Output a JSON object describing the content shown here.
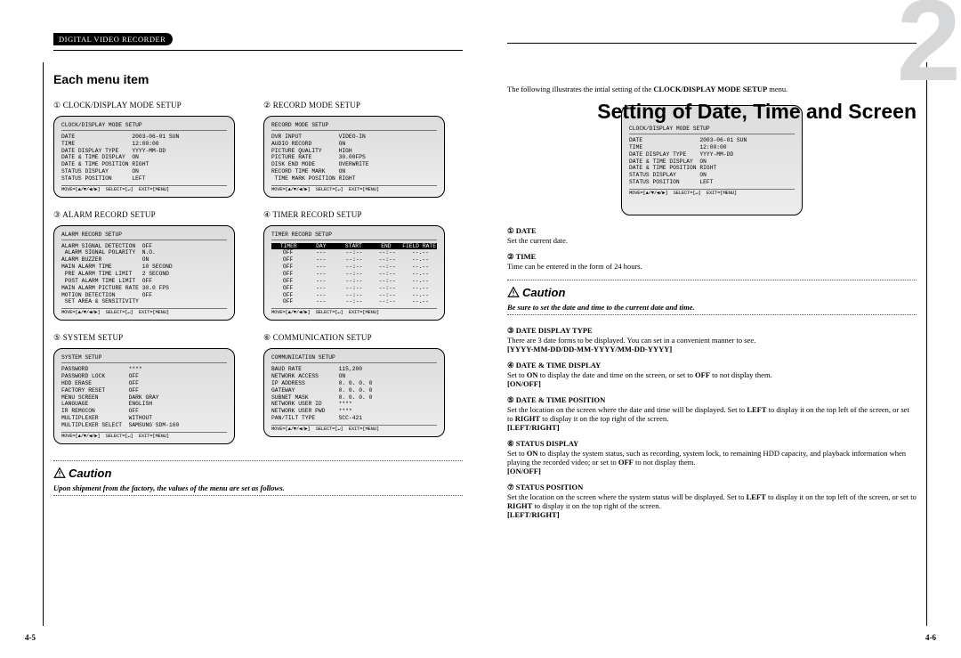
{
  "header_tag": "DIGITAL VIDEO RECORDER",
  "left": {
    "section_title": "Each menu item",
    "menus": [
      {
        "num": "①",
        "title": "CLOCK/DISPLAY MODE SETUP",
        "osd_title": "CLOCK/DISPLAY MODE SETUP",
        "osd_body": "DATE                 2003-06-01 SUN\nTIME                 12:00:00\nDATE DISPLAY TYPE    YYYY-MM-DD\nDATE & TIME DISPLAY  ON\nDATE & TIME POSITION RIGHT\nSTATUS DISPLAY       ON\nSTATUS POSITION      LEFT",
        "osd_foot": "MOVE=[▲/▼/◀/▶]  SELECT=[↵]  EXIT=[MENU]"
      },
      {
        "num": "②",
        "title": "RECORD MODE SETUP",
        "osd_title": "RECORD MODE SETUP",
        "osd_body": "DVR INPUT           VIDEO-IN\nAUDIO RECORD        ON\nPICTURE QUALITY     HIGH\nPICTURE RATE        30.00FPS\nDISK END MODE       OVERWRITE\nRECORD TIME MARK    ON\n TIME MARK POSITION RIGHT",
        "osd_foot": "MOVE=[▲/▼/◀/▶]  SELECT=[↵]  EXIT=[MENU]"
      },
      {
        "num": "③",
        "title": "ALARM RECORD SETUP",
        "osd_title": "ALARM RECORD SETUP",
        "osd_body": "ALARM SIGNAL DETECTION  OFF\n ALARM SIGNAL POLARITY  N.O.\nALARM BUZZER            ON\nMAIN ALARM TIME         10 SECOND\n PRE ALARM TIME LIMIT   2 SECOND\n POST ALARM TIME LIMIT  OFF\nMAIN ALARM PICTURE RATE 30.0 FPS\nMOTION DETECTION        OFF\n SET AREA & SENSITIVITY",
        "osd_foot": "MOVE=[▲/▼/◀/▶]  SELECT=[↵]  EXIT=[MENU]"
      },
      {
        "num": "④",
        "title": "TIMER RECORD SETUP",
        "osd_title": "TIMER RECORD SETUP",
        "osd_header": [
          "TIMER",
          "DAY",
          "START",
          "END",
          "FIELD RATE"
        ],
        "osd_rows": [
          [
            "OFF",
            "---",
            "--:--",
            "--:--",
            "--.--"
          ],
          [
            "OFF",
            "---",
            "--:--",
            "--:--",
            "--.--"
          ],
          [
            "OFF",
            "---",
            "--:--",
            "--:--",
            "--.--"
          ],
          [
            "OFF",
            "---",
            "--:--",
            "--:--",
            "--.--"
          ],
          [
            "OFF",
            "---",
            "--:--",
            "--:--",
            "--.--"
          ],
          [
            "OFF",
            "---",
            "--:--",
            "--:--",
            "--.--"
          ],
          [
            "OFF",
            "---",
            "--:--",
            "--:--",
            "--.--"
          ],
          [
            "OFF",
            "---",
            "--:--",
            "--:--",
            "--.--"
          ]
        ],
        "osd_foot": "MOVE=[▲/▼/◀/▶]  SELECT=[↵]  EXIT=[MENU]"
      },
      {
        "num": "⑤",
        "title": "SYSTEM SETUP",
        "osd_title": "SYSTEM SETUP",
        "osd_body": "PASSWORD            ****\nPASSWORD LOCK       OFF\nHDD ERASE           OFF\nFACTORY RESET       OFF\nMENU SCREEN         DARK GRAY\nLANGUAGE            ENGLISH\nIR REMOCON          OFF\nMULTIPLEXER         WITHOUT\nMULTIPLEXER SELECT  SAMSUNG SDM-160",
        "osd_foot": "MOVE=[▲/▼/◀/▶]  SELECT=[↵]  EXIT=[MENU]"
      },
      {
        "num": "⑥",
        "title": "COMMUNICATION SETUP",
        "osd_title": "COMMUNICATION SETUP",
        "osd_body": "BAUD RATE           115,200\nNETWORK ACCESS      ON\nIP ADDRESS          0. 0. 0. 0\nGATEWAY             0. 0. 0. 0\nSUBNET MASK         0. 0. 0. 0\nNETWORK USER ID     ****\nNETWORK USER PWD    ****\nPAN/TILT TYPE       SCC-421",
        "osd_foot": "MOVE=[▲/▼/◀/▶]  SELECT=[↵]  EXIT=[MENU]"
      }
    ],
    "caution_label": "Caution",
    "caution_text": "Upon shipment from the factory, the values of the menu are set as follows.",
    "page_num": "4-5"
  },
  "right": {
    "big_number": "2",
    "chapter_title": "Setting of Date, Time and Screen",
    "intro_prefix": "The following illustrates the intial setting of the ",
    "intro_bold": "CLOCK/DISPLAY MODE SETUP",
    "intro_suffix": " menu.",
    "osd": {
      "osd_title": "CLOCK/DISPLAY MODE SETUP",
      "osd_body": "DATE                 2003-06-01 SUN\nTIME                 12:00:00\nDATE DISPLAY TYPE    YYYY-MM-DD\nDATE & TIME DISPLAY  ON\nDATE & TIME POSITION RIGHT\nSTATUS DISPLAY       ON\nSTATUS POSITION      LEFT",
      "osd_foot": "MOVE=[▲/▼/◀/▶]  SELECT=[↵]  EXIT=[MENU]"
    },
    "items_top": [
      {
        "num": "①",
        "title": "DATE",
        "body": "Set the current date."
      },
      {
        "num": "②",
        "title": "TIME",
        "body": "Time can be entered in the form of 24 hours."
      }
    ],
    "caution_label": "Caution",
    "caution_text": "Be sure to set the date and time to the current date and time.",
    "items_bottom": [
      {
        "num": "③",
        "title": "DATE DISPLAY TYPE",
        "body": "There are 3 date forms to be displayed. You can set in a convenient manner to see.",
        "opts": "[YYYY-MM-DD/DD-MM-YYYY/MM-DD-YYYY]"
      },
      {
        "num": "④",
        "title": "DATE & TIME DISPLAY",
        "body_parts": [
          "Set to ",
          "ON",
          " to display the date and time on the screen, or set to ",
          "OFF",
          " to not display them."
        ],
        "opts": "[ON/OFF]"
      },
      {
        "num": "⑤",
        "title": "DATE & TIME POSITION",
        "body_parts": [
          "Set the location on the screen where the date and time will be displayed. Set to ",
          "LEFT",
          " to display it on the top left of the screen, or set to ",
          "RIGHT",
          " to display it on the top right of the screen. "
        ],
        "opts": "[LEFT/RIGHT]"
      },
      {
        "num": "⑥",
        "title": "STATUS DISPLAY",
        "body_parts": [
          "Set to ",
          "ON",
          " to display the system status, such as recording, system lock, to remaining HDD capacity, and playback information when playing the recorded video; or set to ",
          "OFF",
          " to not display them. "
        ],
        "opts": "[ON/OFF]"
      },
      {
        "num": "⑦",
        "title": "STATUS POSITION",
        "body_parts": [
          "Set the location on the screen where the system status will be displayed. Set to ",
          "LEFT",
          " to display it on the top left of the screen, or set to ",
          "RIGHT",
          " to display it on the top right of the screen. "
        ],
        "opts": "[LEFT/RIGHT]"
      }
    ],
    "page_num": "4-6"
  }
}
